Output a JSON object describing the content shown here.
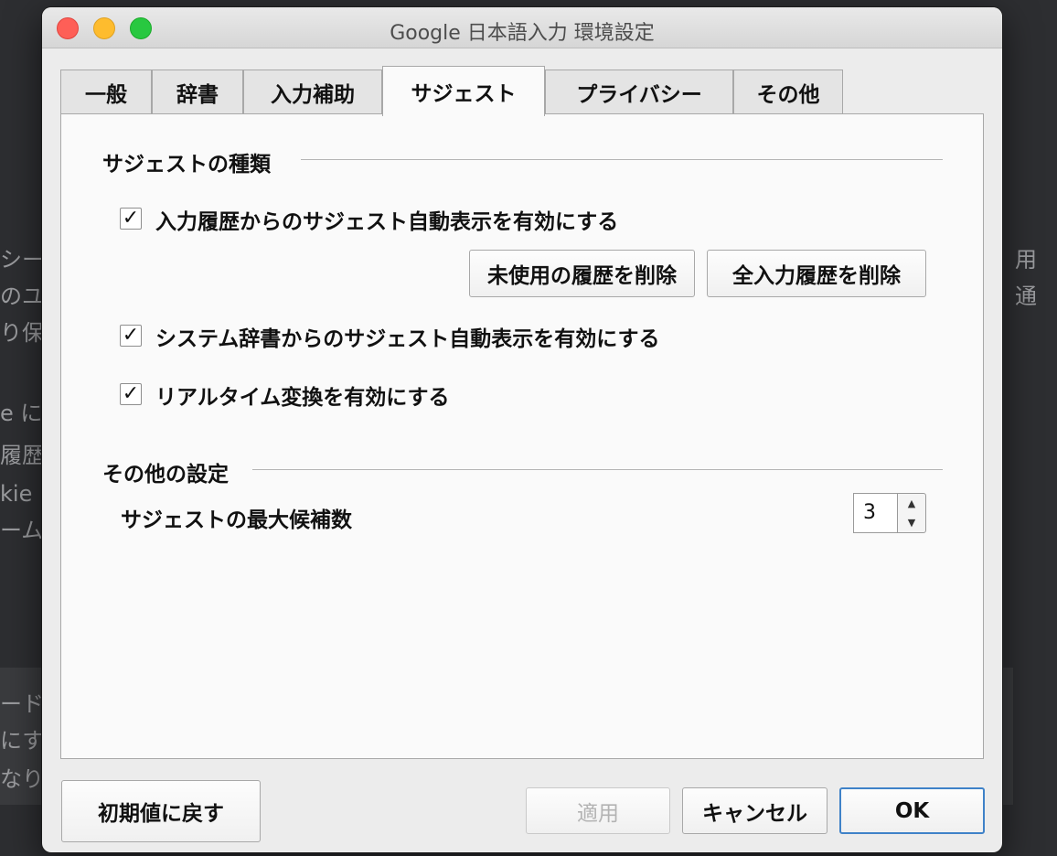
{
  "window": {
    "title": "Google 日本語入力 環境設定"
  },
  "tabs": [
    {
      "label": "一般",
      "active": false
    },
    {
      "label": "辞書",
      "active": false
    },
    {
      "label": "入力補助",
      "active": false
    },
    {
      "label": "サジェスト",
      "active": true
    },
    {
      "label": "プライバシー",
      "active": false
    },
    {
      "label": "その他",
      "active": false
    }
  ],
  "suggest_types": {
    "heading": "サジェストの種類",
    "history_suggest": {
      "label": "入力履歴からのサジェスト自動表示を有効にする",
      "checked": true
    },
    "delete_unused_button": "未使用の履歴を削除",
    "delete_all_button": "全入力履歴を削除",
    "system_dict_suggest": {
      "label": "システム辞書からのサジェスト自動表示を有効にする",
      "checked": true
    },
    "realtime_conversion": {
      "label": "リアルタイム変換を有効にする",
      "checked": true
    }
  },
  "other_settings": {
    "heading": "その他の設定",
    "max_candidates_label": "サジェストの最大候補数",
    "max_candidates_value": "3"
  },
  "footer": {
    "reset_button": "初期値に戻す",
    "apply_button": "適用",
    "cancel_button": "キャンセル",
    "ok_button": "OK"
  },
  "background_fragments": {
    "left": [
      "シー",
      "のユ",
      "り保",
      "e に",
      "履歴",
      "kie と",
      "ーム",
      "ードバ",
      "にす",
      "なり"
    ],
    "right": [
      "用",
      "通"
    ]
  },
  "check_mark": "✓",
  "spin_up_glyph": "▲",
  "spin_down_glyph": "▼"
}
